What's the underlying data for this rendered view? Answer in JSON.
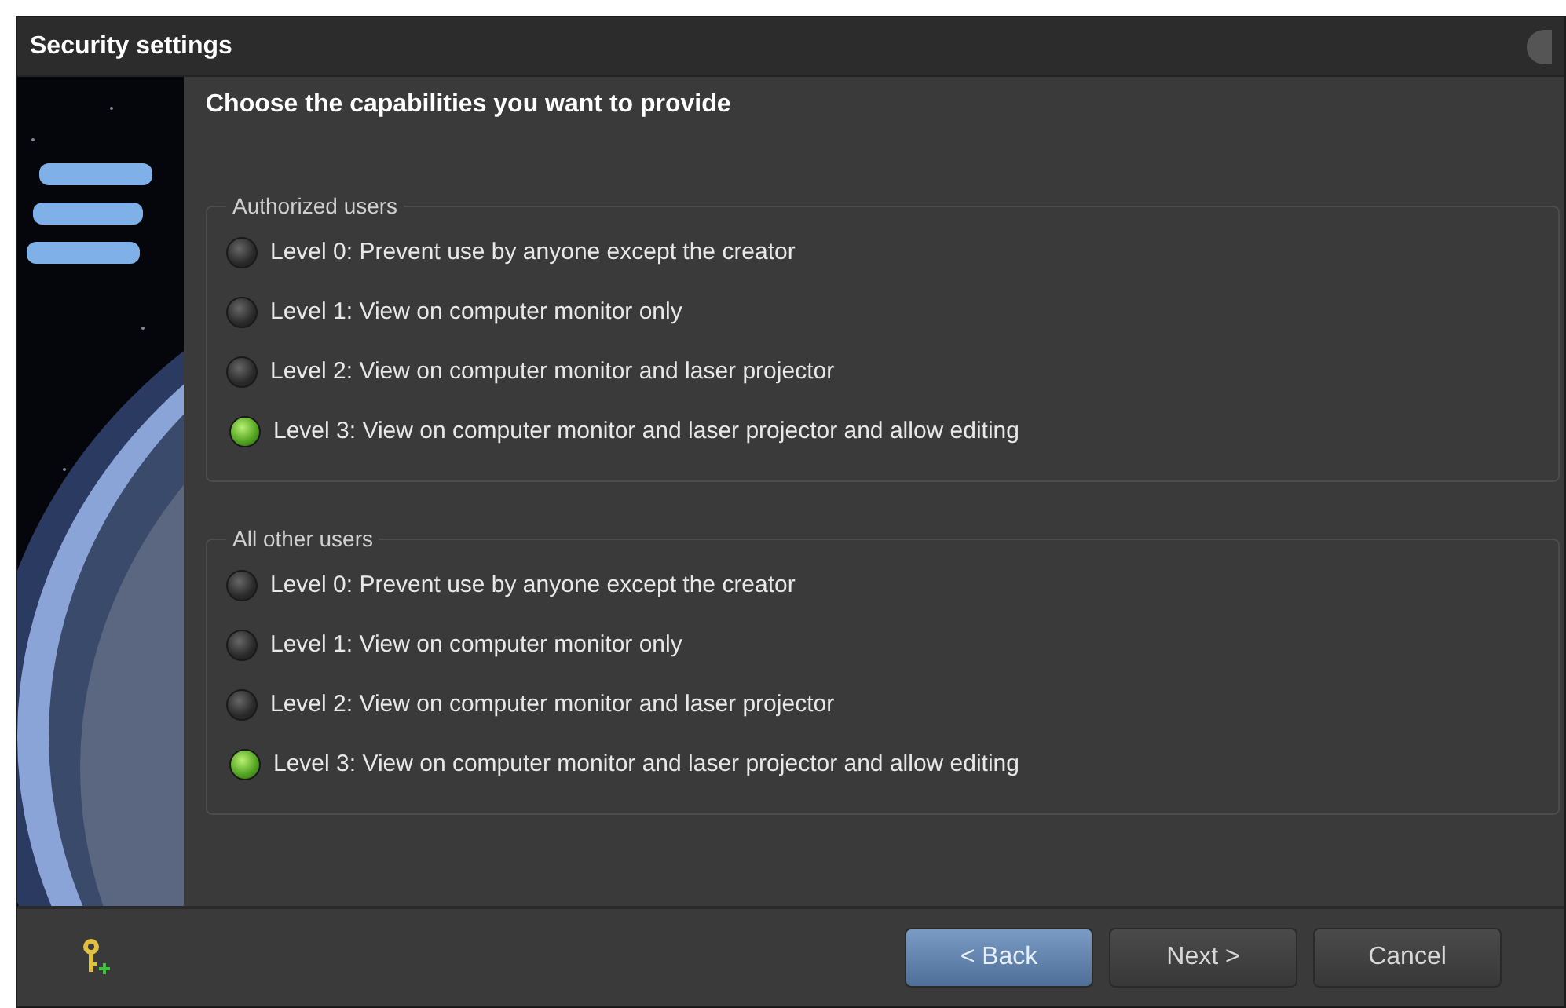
{
  "window": {
    "title": "Security settings"
  },
  "heading": "Choose the capabilities you want to provide",
  "groups": [
    {
      "label": "Authorized users",
      "options": [
        {
          "label": "Level 0: Prevent use by anyone except the creator",
          "selected": false
        },
        {
          "label": "Level 1: View on computer monitor only",
          "selected": false
        },
        {
          "label": "Level 2: View on computer monitor and laser projector",
          "selected": false
        },
        {
          "label": "Level 3: View on computer monitor and laser projector and allow editing",
          "selected": true
        }
      ]
    },
    {
      "label": "All other users",
      "options": [
        {
          "label": "Level 0: Prevent use by anyone except the creator",
          "selected": false
        },
        {
          "label": "Level 1: View on computer monitor only",
          "selected": false
        },
        {
          "label": "Level 2: View on computer monitor and laser projector",
          "selected": false
        },
        {
          "label": "Level 3: View on computer monitor and laser projector and allow editing",
          "selected": true
        }
      ]
    }
  ],
  "buttons": [
    {
      "label": "< Back",
      "kind": "primary"
    },
    {
      "label": "Next >",
      "kind": "normal"
    },
    {
      "label": "Cancel",
      "kind": "normal"
    }
  ]
}
